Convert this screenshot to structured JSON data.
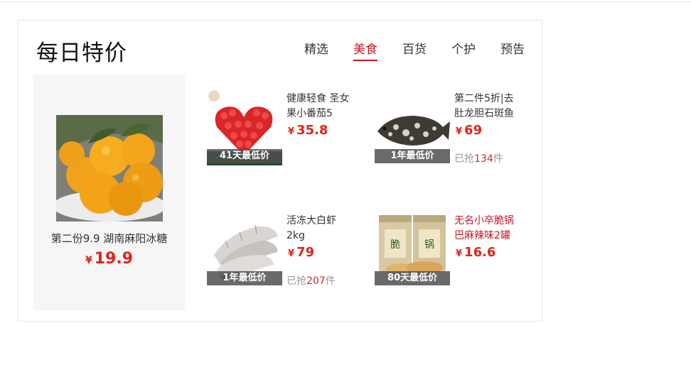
{
  "section": {
    "title": "每日特价",
    "tabs": [
      {
        "label": "精选",
        "active": false
      },
      {
        "label": "美食",
        "active": true
      },
      {
        "label": "百货",
        "active": false
      },
      {
        "label": "个护",
        "active": false
      },
      {
        "label": "预告",
        "active": false
      }
    ]
  },
  "feature": {
    "name": "第二份9.9 湖南麻阳冰糖",
    "currency": "¥",
    "price": "19.9",
    "image": "oranges-in-bowl"
  },
  "items": [
    {
      "name": "健康轻食 圣女果小番茄5",
      "currency": "¥",
      "price": "35.8",
      "tag": "41天最低价",
      "image": "cherry-tomato-heart"
    },
    {
      "name": "第二件5折|去肚龙胆石斑鱼",
      "currency": "¥",
      "price": "69",
      "tag": "1年最低价",
      "sold_prefix": "已抢",
      "sold_count": "134",
      "sold_suffix": "件",
      "image": "grouper-fish"
    },
    {
      "name": "活冻大白虾2kg",
      "currency": "¥",
      "price": "79",
      "tag": "1年最低价",
      "sold_prefix": "已抢",
      "sold_count": "207",
      "sold_suffix": "件",
      "image": "frozen-shrimp"
    },
    {
      "name": "无名小卒脆锅巴麻辣味2罐",
      "currency": "¥",
      "price": "16.6",
      "tag": "80天最低价",
      "image": "crispy-rice-jars",
      "highlight_color": "#c81623"
    }
  ],
  "colors": {
    "accent": "#c81623",
    "price": "#e1251b",
    "tag_bg": "#505050"
  }
}
